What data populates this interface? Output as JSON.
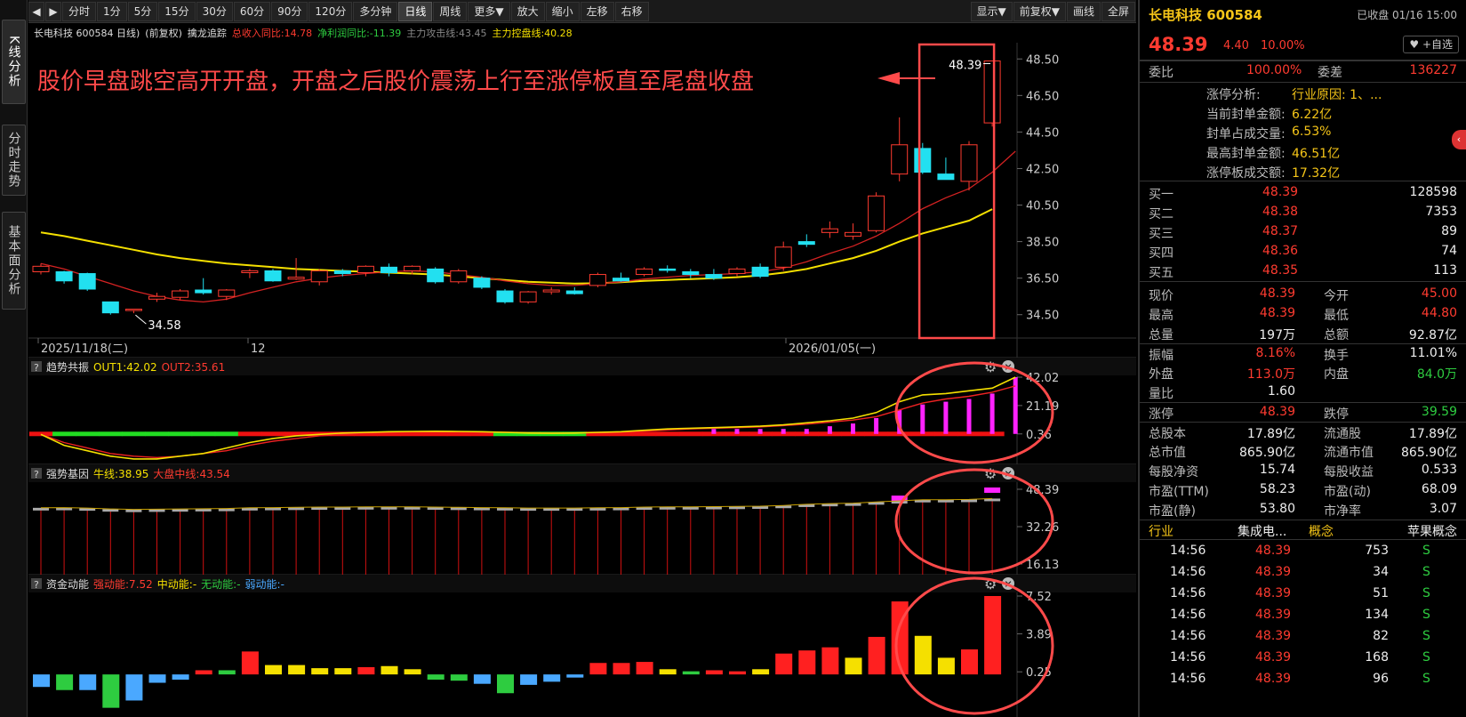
{
  "sidebar": {
    "tabs": [
      {
        "label": "K线分析",
        "active": true
      },
      {
        "label": "分时走势",
        "active": false
      },
      {
        "label": "基本面分析",
        "active": false
      }
    ]
  },
  "toolbar": {
    "prev_arrow": "◀",
    "next_arrow": "▶",
    "items": [
      "分时",
      "1分",
      "5分",
      "15分",
      "30分",
      "60分",
      "90分",
      "120分",
      "多分钟",
      "日线",
      "周线",
      "更多▼",
      "放大",
      "缩小",
      "左移",
      "右移"
    ],
    "active_item": "日线",
    "right_items": [
      "显示▼",
      "前复权▼",
      "画线",
      "全屏"
    ]
  },
  "infobar": {
    "stock": "长电科技 600584 日线)",
    "adjust": "(前复权)",
    "indicator": "擒龙追踪",
    "rev": "总收入同比:14.78",
    "profit": "净利润同比:-11.39",
    "attack": "主力攻击线:43.45",
    "control": "主力控盘线:40.28"
  },
  "annotation": {
    "text": "股价早盘跳空高开开盘，开盘之后股价震荡上行至涨停板直至尾盘收盘",
    "close_label": "48.39",
    "low_label": "34.58"
  },
  "axis": {
    "price_ticks": [
      "48.50",
      "46.50",
      "44.50",
      "42.50",
      "40.50",
      "38.50",
      "36.50",
      "34.50"
    ],
    "date_labels": [
      "2025/11/18(二)",
      "12",
      "2026/01/05(一)"
    ]
  },
  "panels": {
    "p1": {
      "q": "?",
      "title": "趋势共振",
      "v1": "OUT1:42.02",
      "v2": "OUT2:35.61",
      "ticks": [
        "42.02",
        "21.19",
        "0.36"
      ]
    },
    "p2": {
      "q": "?",
      "title": "强势基因",
      "v1": "牛线:38.95",
      "v2": "大盘中线:43.54",
      "ticks": [
        "48.39",
        "32.26",
        "16.13"
      ]
    },
    "p3": {
      "q": "?",
      "title": "资金动能",
      "v1": "强动能:7.52",
      "v2": "中动能:-",
      "v3": "无动能:-",
      "v4": "弱动能:-",
      "ticks": [
        "7.52",
        "3.89",
        "0.25"
      ]
    }
  },
  "colors": {
    "up": "#ff3b30",
    "down": "#22e0f0",
    "ma5": "#d32222",
    "ma20": "#f5e000",
    "annotation": "#ff4a4a",
    "magenta": "#ff22ff"
  },
  "chart_data": {
    "type": "candlestick",
    "ylim": [
      34.0,
      49.0
    ],
    "candles": [
      {
        "o": 36.85,
        "h": 37.3,
        "l": 36.7,
        "c": 37.15
      },
      {
        "o": 36.85,
        "h": 36.9,
        "l": 36.2,
        "c": 36.35
      },
      {
        "o": 36.75,
        "h": 36.8,
        "l": 35.8,
        "c": 35.9
      },
      {
        "o": 35.2,
        "h": 35.2,
        "l": 34.5,
        "c": 34.6
      },
      {
        "o": 34.75,
        "h": 34.8,
        "l": 34.58,
        "c": 34.8
      },
      {
        "o": 35.35,
        "h": 35.7,
        "l": 35.2,
        "c": 35.5
      },
      {
        "o": 35.45,
        "h": 35.9,
        "l": 35.3,
        "c": 35.8
      },
      {
        "o": 35.85,
        "h": 36.5,
        "l": 35.6,
        "c": 35.7
      },
      {
        "o": 35.5,
        "h": 35.9,
        "l": 35.3,
        "c": 35.85
      },
      {
        "o": 36.8,
        "h": 37.0,
        "l": 36.5,
        "c": 36.9
      },
      {
        "o": 36.9,
        "h": 37.0,
        "l": 36.3,
        "c": 36.35
      },
      {
        "o": 36.45,
        "h": 37.6,
        "l": 36.4,
        "c": 36.55
      },
      {
        "o": 36.3,
        "h": 37.0,
        "l": 36.1,
        "c": 36.9
      },
      {
        "o": 36.9,
        "h": 37.0,
        "l": 36.6,
        "c": 36.75
      },
      {
        "o": 36.8,
        "h": 37.2,
        "l": 36.6,
        "c": 37.15
      },
      {
        "o": 37.1,
        "h": 37.3,
        "l": 36.6,
        "c": 36.8
      },
      {
        "o": 36.9,
        "h": 37.2,
        "l": 36.7,
        "c": 37.15
      },
      {
        "o": 37.0,
        "h": 37.1,
        "l": 36.2,
        "c": 36.3
      },
      {
        "o": 36.3,
        "h": 37.0,
        "l": 36.2,
        "c": 36.9
      },
      {
        "o": 36.5,
        "h": 36.6,
        "l": 35.9,
        "c": 36.0
      },
      {
        "o": 35.8,
        "h": 35.9,
        "l": 35.1,
        "c": 35.2
      },
      {
        "o": 35.2,
        "h": 35.8,
        "l": 35.1,
        "c": 35.75
      },
      {
        "o": 35.75,
        "h": 36.0,
        "l": 35.6,
        "c": 35.85
      },
      {
        "o": 35.8,
        "h": 36.0,
        "l": 35.6,
        "c": 35.65
      },
      {
        "o": 36.1,
        "h": 36.8,
        "l": 36.0,
        "c": 36.7
      },
      {
        "o": 36.5,
        "h": 36.8,
        "l": 36.3,
        "c": 36.35
      },
      {
        "o": 36.7,
        "h": 37.1,
        "l": 36.6,
        "c": 37.0
      },
      {
        "o": 37.0,
        "h": 37.2,
        "l": 36.8,
        "c": 36.95
      },
      {
        "o": 36.85,
        "h": 37.0,
        "l": 36.5,
        "c": 36.7
      },
      {
        "o": 36.7,
        "h": 37.0,
        "l": 36.4,
        "c": 36.5
      },
      {
        "o": 36.75,
        "h": 37.1,
        "l": 36.6,
        "c": 37.0
      },
      {
        "o": 37.1,
        "h": 37.3,
        "l": 36.5,
        "c": 36.6
      },
      {
        "o": 37.1,
        "h": 38.5,
        "l": 36.9,
        "c": 38.2
      },
      {
        "o": 38.5,
        "h": 38.9,
        "l": 38.2,
        "c": 38.35
      },
      {
        "o": 39.0,
        "h": 39.6,
        "l": 38.7,
        "c": 39.2
      },
      {
        "o": 38.8,
        "h": 39.5,
        "l": 38.6,
        "c": 39.0
      },
      {
        "o": 39.1,
        "h": 41.2,
        "l": 39.0,
        "c": 41.0
      },
      {
        "o": 42.2,
        "h": 45.3,
        "l": 41.8,
        "c": 43.8
      },
      {
        "o": 43.6,
        "h": 43.9,
        "l": 42.2,
        "c": 42.3
      },
      {
        "o": 42.2,
        "h": 43.1,
        "l": 41.9,
        "c": 41.9
      },
      {
        "o": 41.8,
        "h": 44.0,
        "l": 41.3,
        "c": 43.8
      },
      {
        "o": 45.0,
        "h": 48.39,
        "l": 44.8,
        "c": 48.39
      }
    ],
    "ma_red": [
      37.3,
      37.0,
      36.6,
      36.2,
      35.8,
      35.5,
      35.3,
      35.2,
      35.35,
      35.7,
      36.0,
      36.3,
      36.5,
      36.65,
      36.75,
      36.85,
      36.9,
      36.85,
      36.7,
      36.55,
      36.35,
      36.2,
      36.1,
      36.1,
      36.2,
      36.3,
      36.45,
      36.55,
      36.65,
      36.7,
      36.75,
      36.85,
      37.05,
      37.4,
      37.85,
      38.25,
      38.8,
      39.5,
      40.3,
      40.9,
      41.4,
      42.3,
      43.45
    ],
    "ma_yellow": [
      39.0,
      38.8,
      38.55,
      38.3,
      38.05,
      37.8,
      37.6,
      37.45,
      37.3,
      37.2,
      37.1,
      37.0,
      36.95,
      36.9,
      36.85,
      36.8,
      36.75,
      36.7,
      36.6,
      36.5,
      36.4,
      36.3,
      36.25,
      36.2,
      36.22,
      36.28,
      36.35,
      36.4,
      36.45,
      36.5,
      36.55,
      36.65,
      36.8,
      37.0,
      37.3,
      37.6,
      38.0,
      38.5,
      38.95,
      39.3,
      39.65,
      40.28
    ],
    "p1_out1": [
      0.0,
      -8,
      -12,
      -16,
      -18,
      -18,
      -16,
      -14,
      -10,
      -6,
      -3,
      -1,
      0,
      1,
      1.5,
      2,
      2.2,
      2.3,
      2.2,
      2.0,
      1.5,
      1.0,
      0.8,
      1.0,
      1.5,
      2.0,
      3.0,
      4.0,
      4.5,
      5.0,
      5.5,
      6.0,
      7,
      8.5,
      10,
      12,
      16,
      24,
      29,
      30,
      32,
      34,
      42.02
    ],
    "p1_out2": [
      0.0,
      -6,
      -10,
      -14,
      -16,
      -17,
      -16,
      -14,
      -12,
      -8,
      -5,
      -3,
      -1,
      0,
      1,
      1.5,
      2,
      2,
      2,
      1.8,
      1.5,
      1.2,
      1.0,
      1.0,
      1.2,
      1.8,
      2.5,
      3.2,
      4.0,
      4.5,
      5.0,
      5.5,
      6.5,
      7.5,
      9,
      10.5,
      13,
      18,
      23,
      26,
      28,
      31,
      35.61
    ],
    "p1_bars": [
      0,
      0,
      0,
      0,
      0,
      0,
      0,
      0,
      0,
      0,
      0,
      0,
      0,
      0,
      0,
      0,
      0,
      0,
      0,
      0,
      0,
      0,
      0,
      0,
      0,
      0,
      0,
      0,
      0,
      4,
      4,
      4,
      4,
      4,
      6,
      8,
      12,
      18,
      22,
      24,
      26,
      30,
      42.02
    ],
    "p1_bg": [
      "red",
      "green",
      "green",
      "green",
      "green",
      "green",
      "green",
      "green",
      "green",
      "red",
      "red",
      "red",
      "red",
      "red",
      "red",
      "red",
      "red",
      "red",
      "red",
      "red",
      "green",
      "green",
      "green",
      "green",
      "red",
      "red",
      "red",
      "red",
      "red",
      "red",
      "red",
      "red",
      "red",
      "red",
      "red",
      "red",
      "red",
      "red",
      "red",
      "red",
      "red",
      "red"
    ],
    "p2_gray": [
      40.0,
      40.1,
      39.9,
      39.5,
      39.3,
      39.4,
      39.5,
      39.6,
      39.7,
      40.0,
      40.1,
      40.2,
      40.3,
      40.3,
      40.4,
      40.4,
      40.4,
      40.3,
      40.2,
      40.1,
      40.0,
      39.9,
      39.9,
      39.9,
      40.0,
      40.1,
      40.3,
      40.4,
      40.4,
      40.5,
      40.6,
      40.7,
      41.0,
      41.5,
      41.8,
      42.0,
      42.5,
      43.0,
      43.5,
      43.5,
      43.6,
      44.0
    ],
    "p2_magenta": [
      0,
      0,
      0,
      0,
      0,
      0,
      0,
      0,
      0,
      0,
      0,
      0,
      0,
      0,
      0,
      0,
      0,
      0,
      0,
      0,
      0,
      0,
      0,
      0,
      0,
      0,
      0,
      0,
      0,
      0,
      0,
      0,
      0,
      0,
      0,
      0,
      0,
      44.5,
      0,
      0,
      0,
      48.0
    ],
    "p3_vals": [
      -1.2,
      -1.5,
      -1.5,
      -3.2,
      -2.5,
      -0.8,
      -0.5,
      0.4,
      0.4,
      2.2,
      0.9,
      0.9,
      0.6,
      0.6,
      0.7,
      0.8,
      0.5,
      -0.5,
      -0.6,
      -0.9,
      -1.8,
      -1.0,
      -0.7,
      -0.3,
      1.1,
      1.1,
      1.2,
      0.5,
      0.3,
      0.4,
      0.3,
      0.5,
      2.0,
      2.3,
      2.6,
      1.6,
      3.6,
      7.0,
      3.7,
      1.6,
      2.4,
      7.52
    ],
    "p3_colors": [
      "#4aa8ff",
      "#2ecc40",
      "#4aa8ff",
      "#2ecc40",
      "#4aa8ff",
      "#4aa8ff",
      "#4aa8ff",
      "#ff2020",
      "#2ecc40",
      "#ff2020",
      "#f5e000",
      "#f5e000",
      "#f5e000",
      "#f5e000",
      "#ff2020",
      "#f5e000",
      "#f5e000",
      "#2ecc40",
      "#2ecc40",
      "#4aa8ff",
      "#2ecc40",
      "#4aa8ff",
      "#4aa8ff",
      "#4aa8ff",
      "#ff2020",
      "#ff2020",
      "#ff2020",
      "#f5e000",
      "#2ecc40",
      "#ff2020",
      "#ff2020",
      "#f5e000",
      "#ff2020",
      "#ff2020",
      "#ff2020",
      "#f5e000",
      "#ff2020",
      "#ff2020",
      "#f5e000",
      "#f5e000",
      "#ff2020",
      "#ff2020"
    ]
  },
  "quote": {
    "name": "长电科技 600584",
    "status": "已收盘 01/16 15:00",
    "price": "48.39",
    "change": "4.40",
    "pct": "10.00%",
    "fav": "+自选",
    "weibi_label": "委比",
    "weibi": "100.00%",
    "weicha_label": "委差",
    "weicha": "136227",
    "limit": [
      {
        "label": "涨停分析:",
        "value": "行业原因: 1、..."
      },
      {
        "label": "当前封单金额:",
        "value": "6.22亿"
      },
      {
        "label": "封单占成交量:",
        "value": "6.53%"
      },
      {
        "label": "最高封单金额:",
        "value": "46.51亿"
      },
      {
        "label": "涨停板成交额:",
        "value": "17.32亿"
      }
    ],
    "bids": [
      {
        "label": "买一",
        "price": "48.39",
        "vol": "128598"
      },
      {
        "label": "买二",
        "price": "48.38",
        "vol": "7353"
      },
      {
        "label": "买三",
        "price": "48.37",
        "vol": "89"
      },
      {
        "label": "买四",
        "price": "48.36",
        "vol": "74"
      },
      {
        "label": "买五",
        "price": "48.35",
        "vol": "113"
      }
    ],
    "stats": [
      {
        "l1": "现价",
        "v1": "48.39",
        "c1": "red",
        "l2": "今开",
        "v2": "45.00",
        "c2": "red"
      },
      {
        "l1": "最高",
        "v1": "48.39",
        "c1": "red",
        "l2": "最低",
        "v2": "44.80",
        "c2": "red"
      },
      {
        "l1": "总量",
        "v1": "197万",
        "c1": "white",
        "l2": "总额",
        "v2": "92.87亿",
        "c2": "white"
      },
      {
        "l1": "振幅",
        "v1": "8.16%",
        "c1": "red",
        "l2": "换手",
        "v2": "11.01%",
        "c2": "white"
      },
      {
        "l1": "外盘",
        "v1": "113.0万",
        "c1": "red",
        "l2": "内盘",
        "v2": "84.0万",
        "c2": "green"
      },
      {
        "l1": "量比",
        "v1": "1.60",
        "c1": "white",
        "l2": "",
        "v2": "",
        "c2": "white"
      },
      {
        "l1": "涨停",
        "v1": "48.39",
        "c1": "red",
        "l2": "跌停",
        "v2": "39.59",
        "c2": "green"
      },
      {
        "l1": "总股本",
        "v1": "17.89亿",
        "c1": "white",
        "l2": "流通股",
        "v2": "17.89亿",
        "c2": "white"
      },
      {
        "l1": "总市值",
        "v1": "865.90亿",
        "c1": "white",
        "l2": "流通市值",
        "v2": "865.90亿",
        "c2": "white"
      },
      {
        "l1": "每股净资",
        "v1": "15.74",
        "c1": "white",
        "l2": "每股收益",
        "v2": "0.533",
        "c2": "white"
      },
      {
        "l1": "市盈(TTM)",
        "v1": "58.23",
        "c1": "white",
        "l2": "市盈(动)",
        "v2": "68.09",
        "c2": "white"
      },
      {
        "l1": "市盈(静)",
        "v1": "53.80",
        "c1": "white",
        "l2": "市净率",
        "v2": "3.07",
        "c2": "white"
      }
    ],
    "industry_label": "行业",
    "industry": "集成电...",
    "concept_label": "概念",
    "concept": "苹果概念",
    "ticks": [
      {
        "time": "14:56",
        "price": "48.39",
        "vol": "753",
        "bs": "S"
      },
      {
        "time": "14:56",
        "price": "48.39",
        "vol": "34",
        "bs": "S"
      },
      {
        "time": "14:56",
        "price": "48.39",
        "vol": "51",
        "bs": "S"
      },
      {
        "time": "14:56",
        "price": "48.39",
        "vol": "134",
        "bs": "S"
      },
      {
        "time": "14:56",
        "price": "48.39",
        "vol": "82",
        "bs": "S"
      },
      {
        "time": "14:56",
        "price": "48.39",
        "vol": "168",
        "bs": "S"
      },
      {
        "time": "14:56",
        "price": "48.39",
        "vol": "96",
        "bs": "S"
      }
    ]
  }
}
